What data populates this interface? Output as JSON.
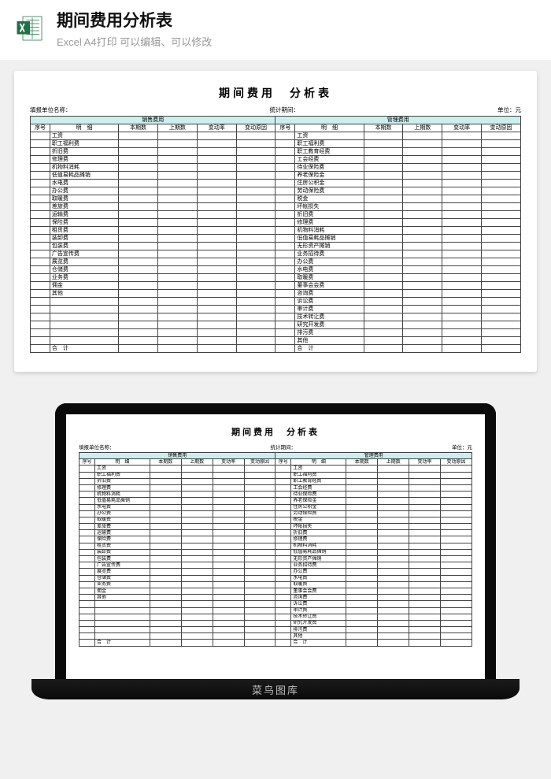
{
  "header": {
    "title": "期间费用分析表",
    "subtitle": "Excel A4打印 可以编辑、可以修改"
  },
  "sheet": {
    "title": "期间费用　分析表",
    "meta": {
      "org_label": "填报单位名称：",
      "period_label": "统计期间：",
      "unit_label": "单位：元"
    },
    "left_section": "销售费用",
    "right_section": "管理费用",
    "cols": {
      "idx": "序号",
      "item": "明　细",
      "current": "本期数",
      "prev": "上期数",
      "rate": "变动率",
      "reason": "变动原因"
    },
    "total_label": "合　计",
    "left_items": [
      "工资",
      "职工福利费",
      "折旧费",
      "修理费",
      "机物料消耗",
      "低值易耗品摊销",
      "水电费",
      "办公费",
      "取暖费",
      "差旅费",
      "运输费",
      "保险费",
      "租赁费",
      "装卸费",
      "包装费",
      "广告宣传费",
      "展览费",
      "仓储费",
      "业务费",
      "佣金",
      "其他",
      "",
      "",
      "",
      "",
      "",
      ""
    ],
    "right_items": [
      "工资",
      "职工福利费",
      "职工教育经费",
      "工会经费",
      "待业保险费",
      "养老保险金",
      "住房公积金",
      "劳动保险费",
      "税金",
      "坏帐损失",
      "折旧费",
      "修理费",
      "机物料消耗",
      "低值易耗品摊销",
      "无形资产摊销",
      "业务招待费",
      "办公费",
      "水电费",
      "取暖费",
      "董事会会费",
      "咨询费",
      "诉讼费",
      "审计费",
      "技术转让费",
      "研究开发费",
      "排污费",
      "其他"
    ]
  },
  "watermark": "菜鸟图库"
}
